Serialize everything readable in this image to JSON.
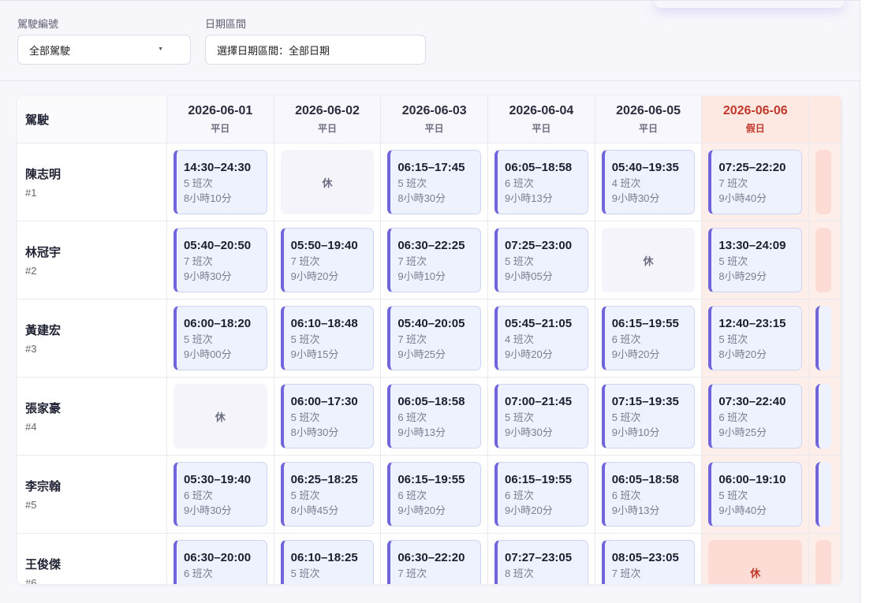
{
  "filters": {
    "driver_label": "駕駛編號",
    "driver_value": "全部駕駛",
    "date_label": "日期區間",
    "date_value": "選擇日期區間：全部日期"
  },
  "table": {
    "driver_header": "駕駛",
    "off_label": "休",
    "days": [
      {
        "date": "2026-06-01",
        "type": "平日",
        "holiday": false
      },
      {
        "date": "2026-06-02",
        "type": "平日",
        "holiday": false
      },
      {
        "date": "2026-06-03",
        "type": "平日",
        "holiday": false
      },
      {
        "date": "2026-06-04",
        "type": "平日",
        "holiday": false
      },
      {
        "date": "2026-06-05",
        "type": "平日",
        "holiday": false
      },
      {
        "date": "2026-06-06",
        "type": "假日",
        "holiday": true
      }
    ],
    "drivers": [
      {
        "name": "陳志明",
        "num": "#1",
        "shifts": [
          {
            "time": "14:30–24:30",
            "count": "5 班次",
            "dur": "8小時10分"
          },
          {
            "off": true
          },
          {
            "time": "06:15–17:45",
            "count": "5 班次",
            "dur": "8小時30分"
          },
          {
            "time": "06:05–18:58",
            "count": "6 班次",
            "dur": "9小時13分"
          },
          {
            "time": "05:40–19:35",
            "count": "4 班次",
            "dur": "9小時30分"
          },
          {
            "time": "07:25–22:20",
            "count": "7 班次",
            "dur": "9小時40分"
          }
        ]
      },
      {
        "name": "林冠宇",
        "num": "#2",
        "shifts": [
          {
            "time": "05:40–20:50",
            "count": "7 班次",
            "dur": "9小時30分"
          },
          {
            "time": "05:50–19:40",
            "count": "7 班次",
            "dur": "9小時20分"
          },
          {
            "time": "06:30–22:25",
            "count": "7 班次",
            "dur": "9小時10分"
          },
          {
            "time": "07:25–23:00",
            "count": "5 班次",
            "dur": "9小時05分"
          },
          {
            "off": true
          },
          {
            "time": "13:30–24:09",
            "count": "5 班次",
            "dur": "8小時29分"
          }
        ]
      },
      {
        "name": "黃建宏",
        "num": "#3",
        "shifts": [
          {
            "time": "06:00–18:20",
            "count": "5 班次",
            "dur": "9小時00分"
          },
          {
            "time": "06:10–18:48",
            "count": "5 班次",
            "dur": "9小時15分"
          },
          {
            "time": "05:40–20:05",
            "count": "7 班次",
            "dur": "9小時25分"
          },
          {
            "time": "05:45–21:05",
            "count": "4 班次",
            "dur": "9小時20分"
          },
          {
            "time": "06:15–19:55",
            "count": "6 班次",
            "dur": "9小時20分"
          },
          {
            "time": "12:40–23:15",
            "count": "5 班次",
            "dur": "8小時20分"
          }
        ]
      },
      {
        "name": "張家豪",
        "num": "#4",
        "shifts": [
          {
            "off": true
          },
          {
            "time": "06:00–17:30",
            "count": "5 班次",
            "dur": "8小時30分"
          },
          {
            "time": "06:05–18:58",
            "count": "6 班次",
            "dur": "9小時13分"
          },
          {
            "time": "07:00–21:45",
            "count": "5 班次",
            "dur": "9小時30分"
          },
          {
            "time": "07:15–19:35",
            "count": "5 班次",
            "dur": "9小時10分"
          },
          {
            "time": "07:30–22:40",
            "count": "6 班次",
            "dur": "9小時25分"
          }
        ]
      },
      {
        "name": "李宗翰",
        "num": "#5",
        "shifts": [
          {
            "time": "05:30–19:40",
            "count": "6 班次",
            "dur": "9小時30分"
          },
          {
            "time": "06:25–18:25",
            "count": "5 班次",
            "dur": "8小時45分"
          },
          {
            "time": "06:15–19:55",
            "count": "6 班次",
            "dur": "9小時20分"
          },
          {
            "time": "06:15–19:55",
            "count": "6 班次",
            "dur": "9小時20分"
          },
          {
            "time": "06:05–18:58",
            "count": "6 班次",
            "dur": "9小時13分"
          },
          {
            "time": "06:00–19:10",
            "count": "5 班次",
            "dur": "9小時40分"
          }
        ]
      },
      {
        "name": "王俊傑",
        "num": "#6",
        "shifts": [
          {
            "time": "06:30–20:00",
            "count": "6 班次",
            "dur": ""
          },
          {
            "time": "06:10–18:25",
            "count": "5 班次",
            "dur": ""
          },
          {
            "time": "06:30–22:20",
            "count": "7 班次",
            "dur": ""
          },
          {
            "time": "07:27–23:05",
            "count": "8 班次",
            "dur": ""
          },
          {
            "time": "08:05–23:05",
            "count": "7 班次",
            "dur": ""
          },
          {
            "off": true
          }
        ]
      }
    ]
  }
}
